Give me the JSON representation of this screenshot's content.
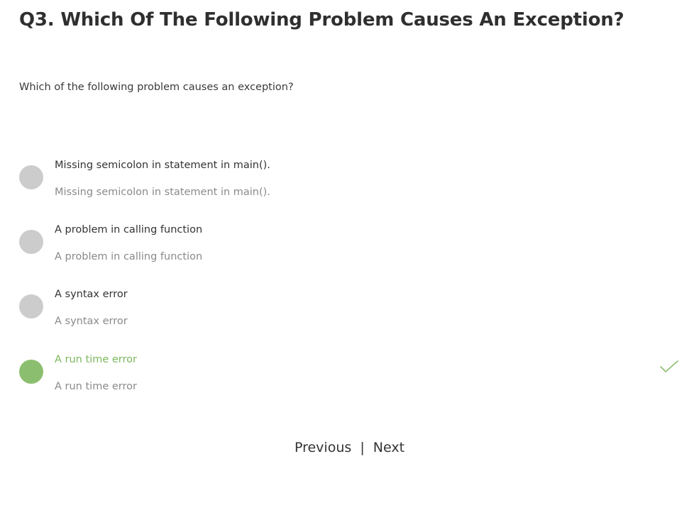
{
  "question": {
    "title": "Q3. Which Of The Following Problem Causes An Exception?",
    "text": "Which of the following problem causes an exception?"
  },
  "options": [
    {
      "label": "Missing semicolon in statement in main().",
      "sublabel": "Missing semicolon in statement in main().",
      "state": "unselected"
    },
    {
      "label": "A problem in calling function",
      "sublabel": "A problem in calling function",
      "state": "unselected"
    },
    {
      "label": "A syntax error",
      "sublabel": "A syntax error",
      "state": "unselected"
    },
    {
      "label": "A run time error",
      "sublabel": "A run time error",
      "state": "correct"
    }
  ],
  "icons": {
    "radio": "circle-icon",
    "correct": "checkmark-icon"
  },
  "colors": {
    "radio_default": "#cccccc",
    "correct": "#8bbf6f",
    "correct_text": "#7cb85c"
  },
  "nav": {
    "previous": "Previous",
    "separator": "|",
    "next": "Next"
  }
}
